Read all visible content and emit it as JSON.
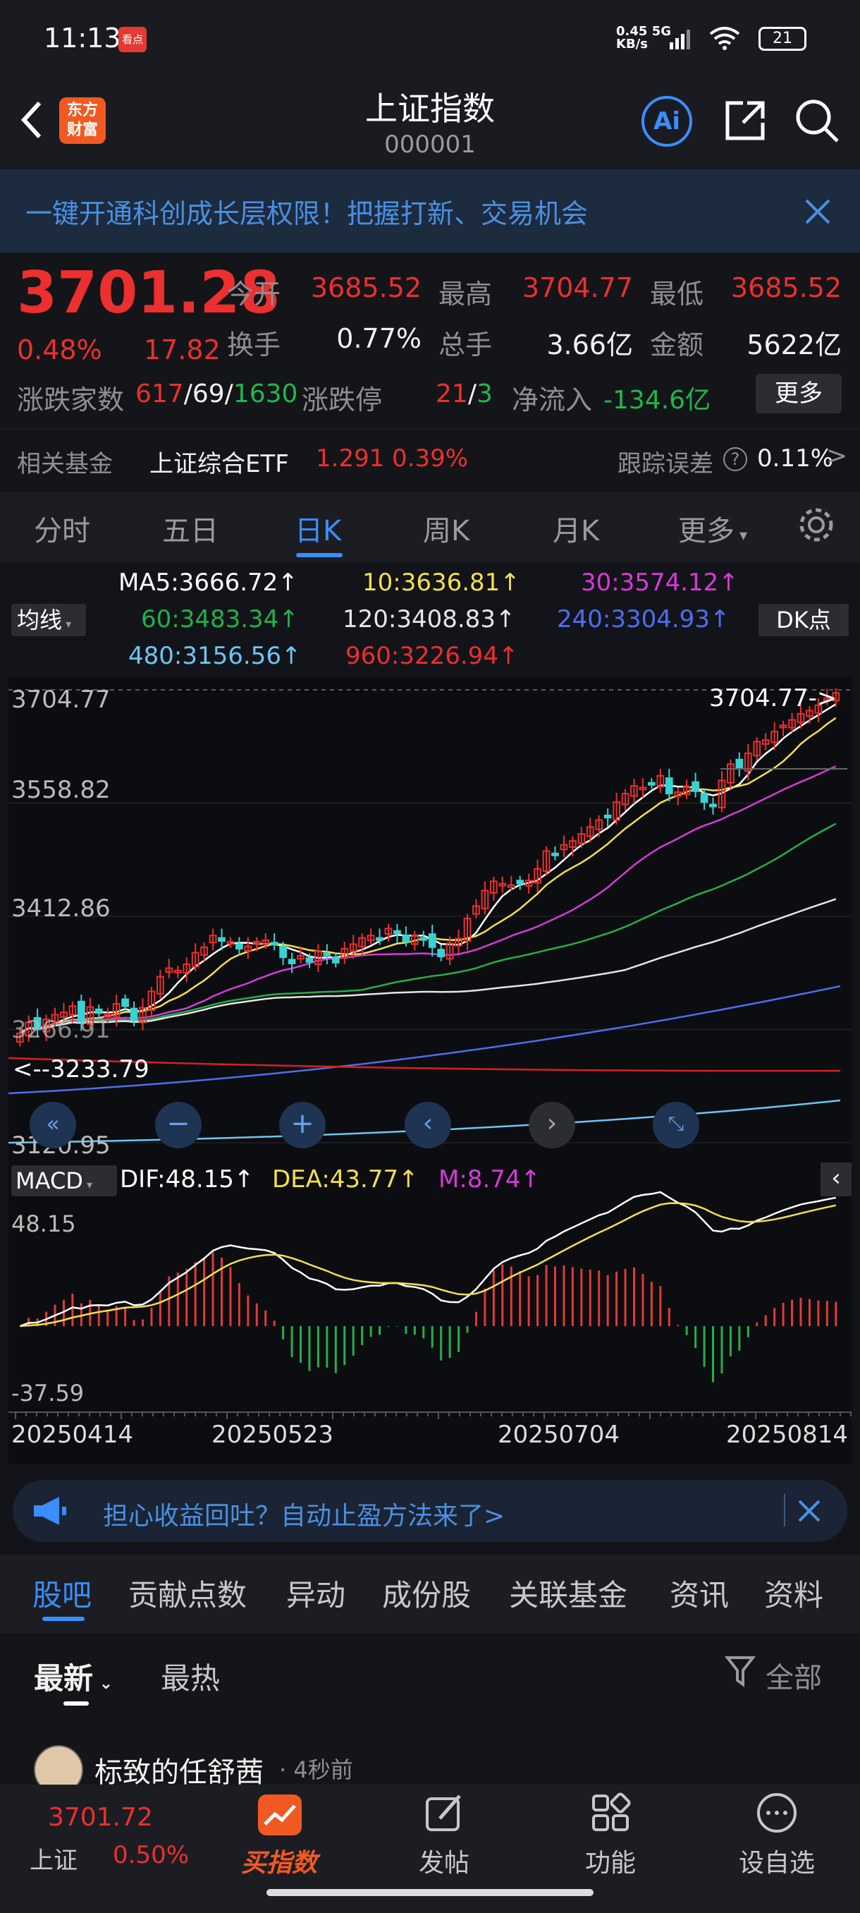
{
  "status": {
    "time": "11:13",
    "app_badge": "看点",
    "net_speed": "0.45",
    "net_unit": "KB/s",
    "net_type": "5G",
    "battery": "21"
  },
  "header": {
    "title": "上证指数",
    "code": "000001",
    "logo_line1": "东方",
    "logo_line2": "财富",
    "ai_label": "Ai"
  },
  "banner": {
    "text": "一键开通科创成长层权限！把握打新、交易机会"
  },
  "quote": {
    "price": "3701.28",
    "change_pct": "0.48%",
    "change": "17.82",
    "open_label": "今开",
    "open": "3685.52",
    "high_label": "最高",
    "high": "3704.77",
    "low_label": "最低",
    "low": "3685.52",
    "turnover_label": "换手",
    "turnover": "0.77%",
    "volume_label": "总手",
    "volume": "3.66亿",
    "amount_label": "金额",
    "amount": "5622亿",
    "breadth_label": "涨跌家数",
    "up": "617",
    "flat": "69",
    "down": "1630",
    "limit_label": "涨跌停",
    "limit_up": "21",
    "limit_down": "3",
    "netflow_label": "净流入",
    "netflow": "-134.6亿",
    "more": "更多"
  },
  "fund": {
    "label": "相关基金",
    "name": "上证综合ETF",
    "price": "1.291",
    "pct": "0.39%",
    "tracking_label": "跟踪误差",
    "tracking": "0.11%"
  },
  "tabs": [
    "分时",
    "五日",
    "日K",
    "周K",
    "月K",
    "更多"
  ],
  "ma": {
    "selector": "均线",
    "dk": "DK点",
    "ma5": "MA5:3666.72↑",
    "ma10": "10:3636.81↑",
    "ma30": "30:3574.12↑",
    "ma60": "60:3483.34↑",
    "ma120": "120:3408.83↑",
    "ma240": "240:3304.93↑",
    "ma480": "480:3156.56↑",
    "ma960": "960:3226.94↑"
  },
  "chart_data": [
    {
      "type": "candlestick",
      "y_ticks": [
        "3704.77",
        "3558.82",
        "3412.86",
        "3266.91",
        "3120.95"
      ],
      "ylim": [
        3120.95,
        3704.77
      ],
      "high_marker": "3704.77->",
      "low_marker": "<--3233.79",
      "close": [
        3262,
        3276,
        3267,
        3280,
        3286,
        3289,
        3297,
        3277,
        3296,
        3288,
        3286,
        3300,
        3297,
        3279,
        3295,
        3316,
        3335,
        3346,
        3343,
        3351,
        3366,
        3373,
        3388,
        3381,
        3380,
        3371,
        3374,
        3380,
        3382,
        3377,
        3360,
        3352,
        3362,
        3354,
        3368,
        3363,
        3353,
        3371,
        3377,
        3385,
        3388,
        3384,
        3397,
        3391,
        3380,
        3388,
        3384,
        3373,
        3361,
        3378,
        3384,
        3410,
        3426,
        3446,
        3458,
        3455,
        3453,
        3455,
        3459,
        3474,
        3497,
        3493,
        3505,
        3510,
        3519,
        3528,
        3537,
        3540,
        3560,
        3571,
        3581,
        3579,
        3583,
        3594,
        3571,
        3573,
        3580,
        3574,
        3560,
        3556,
        3588,
        3609,
        3603,
        3623,
        3638,
        3640,
        3651,
        3659,
        3666,
        3674,
        3678,
        3685,
        3694,
        3701
      ]
    },
    {
      "type": "macd",
      "name": "MACD",
      "dif_label": "DIF:48.15↑",
      "dea_label": "DEA:43.77↑",
      "m_label": "M:8.74↑",
      "y_top": "48.15",
      "y_bottom": "-37.59",
      "x_ticks": [
        "20250414",
        "20250523",
        "20250704",
        "20250814"
      ]
    }
  ],
  "ad": {
    "text": "担心收益回吐？自动止盈方法来了>"
  },
  "news_tabs": [
    "股吧",
    "贡献点数",
    "异动",
    "成份股",
    "关联基金",
    "资讯",
    "资料"
  ],
  "feed": {
    "sort_new": "最新",
    "sort_hot": "最热",
    "filter": "全部",
    "user": "标致的任舒茜",
    "time": "· 4秒前"
  },
  "bottom": {
    "index_price": "3701.72",
    "index_name": "上证",
    "index_pct": "0.50%",
    "buy": "买指数",
    "post": "发帖",
    "func": "功能",
    "watch": "设自选"
  }
}
